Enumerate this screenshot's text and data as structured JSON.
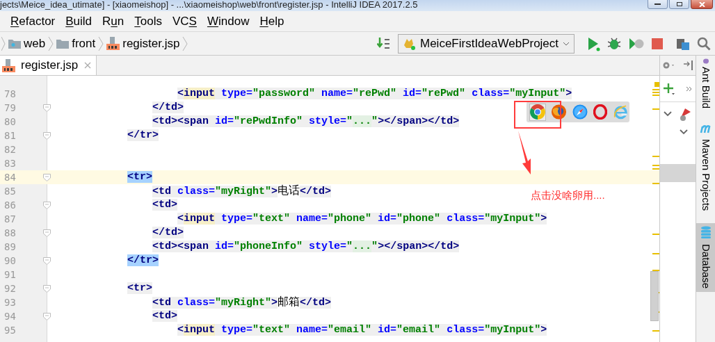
{
  "window": {
    "title": "jects\\Meice_idea_utimate] - [xiaomeishop] - ...\\xiaomeishop\\web\\front\\register.jsp - IntelliJ IDEA 2017.2.5"
  },
  "menu": [
    {
      "key": "R",
      "post": "efactor"
    },
    {
      "key": "B",
      "post": "uild"
    },
    {
      "pre": "R",
      "key": "u",
      "post": "n"
    },
    {
      "key": "T",
      "post": "ools"
    },
    {
      "pre": "VC",
      "key": "S"
    },
    {
      "key": "W",
      "post": "indow"
    },
    {
      "key": "H",
      "post": "elp"
    }
  ],
  "breadcrumbs": [
    {
      "kind": "webfolder",
      "label": "web"
    },
    {
      "kind": "folder",
      "label": "front"
    },
    {
      "kind": "jsp",
      "label": "register.jsp"
    }
  ],
  "run_config": {
    "label": "MeiceFirstIdeaWebProject"
  },
  "tabs": [
    {
      "label": "register.jsp",
      "selected": true
    }
  ],
  "lines": [
    {
      "number": "78",
      "fold": false,
      "current": false,
      "match": false,
      "kind": "input",
      "segs": [
        {
          "kind": "tag",
          "text": "<"
        },
        {
          "kind": "warn",
          "text": "input"
        },
        {
          "kind": "attr",
          "text": " type="
        },
        {
          "kind": "val",
          "text": "\"password\""
        },
        {
          "kind": "attr",
          "text": " name="
        },
        {
          "kind": "val",
          "text": "\"rePwd\""
        },
        {
          "kind": "attr",
          "text": " id="
        },
        {
          "kind": "val",
          "text": "\"rePwd\""
        },
        {
          "kind": "attr",
          "text": " class="
        },
        {
          "kind": "val",
          "text": "\"myInput\""
        },
        {
          "kind": "tag",
          "text": ">"
        }
      ]
    },
    {
      "number": "79",
      "fold": true,
      "current": false,
      "match": false,
      "kind": "td",
      "segs": [
        {
          "kind": "tag",
          "text": "</td>"
        }
      ]
    },
    {
      "number": "80",
      "fold": false,
      "current": false,
      "match": false,
      "kind": "td",
      "segs": [
        {
          "kind": "tag",
          "text": "<td><span"
        },
        {
          "kind": "attr",
          "text": " id="
        },
        {
          "kind": "val",
          "text": "\"rePwdInfo\""
        },
        {
          "kind": "attr",
          "text": " style="
        },
        {
          "kind": "val",
          "text": "\""
        },
        {
          "kind": "folded",
          "text": "..."
        },
        {
          "kind": "val",
          "text": "\""
        },
        {
          "kind": "tag",
          "text": "></span></td>"
        }
      ]
    },
    {
      "number": "81",
      "fold": true,
      "current": false,
      "match": false,
      "kind": "tr",
      "segs": [
        {
          "kind": "tag",
          "text": "</tr>"
        }
      ]
    },
    {
      "number": "82",
      "fold": false,
      "current": false
    },
    {
      "number": "83",
      "fold": false,
      "current": false
    },
    {
      "number": "84",
      "fold": true,
      "current": true,
      "match": true,
      "kind": "tr",
      "segs": [
        {
          "kind": "tag",
          "text": "<tr>"
        }
      ]
    },
    {
      "number": "85",
      "fold": false,
      "current": false,
      "match": false,
      "kind": "td",
      "segs": [
        {
          "kind": "tag",
          "text": "<td"
        },
        {
          "kind": "attr",
          "text": " class="
        },
        {
          "kind": "val",
          "text": "\"myRight\""
        },
        {
          "kind": "tag",
          "text": ">"
        },
        {
          "kind": "text",
          "text": "电话"
        },
        {
          "kind": "tag",
          "text": "</td>"
        }
      ]
    },
    {
      "number": "86",
      "fold": true,
      "current": false,
      "match": false,
      "kind": "td",
      "segs": [
        {
          "kind": "tag",
          "text": "<td>"
        }
      ]
    },
    {
      "number": "87",
      "fold": false,
      "current": false,
      "match": false,
      "kind": "input",
      "segs": [
        {
          "kind": "tag",
          "text": "<"
        },
        {
          "kind": "warn",
          "text": "input"
        },
        {
          "kind": "attr",
          "text": " type="
        },
        {
          "kind": "val",
          "text": "\"text\""
        },
        {
          "kind": "attr",
          "text": " name="
        },
        {
          "kind": "val",
          "text": "\"phone\""
        },
        {
          "kind": "attr",
          "text": " id="
        },
        {
          "kind": "val",
          "text": "\"phone\""
        },
        {
          "kind": "attr",
          "text": " class="
        },
        {
          "kind": "val",
          "text": "\"myInput\""
        },
        {
          "kind": "tag",
          "text": ">"
        }
      ]
    },
    {
      "number": "88",
      "fold": true,
      "current": false,
      "match": false,
      "kind": "td",
      "segs": [
        {
          "kind": "tag",
          "text": "</td>"
        }
      ]
    },
    {
      "number": "89",
      "fold": false,
      "current": false,
      "match": false,
      "kind": "td",
      "segs": [
        {
          "kind": "tag",
          "text": "<td><span"
        },
        {
          "kind": "attr",
          "text": " id="
        },
        {
          "kind": "val",
          "text": "\"phoneInfo\""
        },
        {
          "kind": "attr",
          "text": " style="
        },
        {
          "kind": "val",
          "text": "\""
        },
        {
          "kind": "folded",
          "text": "..."
        },
        {
          "kind": "val",
          "text": "\""
        },
        {
          "kind": "tag",
          "text": "></span></td>"
        }
      ]
    },
    {
      "number": "90",
      "fold": true,
      "current": false,
      "match": true,
      "kind": "tr",
      "segs": [
        {
          "kind": "tag",
          "text": "</tr>"
        }
      ]
    },
    {
      "number": "91",
      "fold": false,
      "current": false
    },
    {
      "number": "92",
      "fold": true,
      "current": false,
      "match": false,
      "kind": "tr",
      "segs": [
        {
          "kind": "tag",
          "text": "<tr>"
        }
      ]
    },
    {
      "number": "93",
      "fold": false,
      "current": false,
      "match": false,
      "kind": "td",
      "segs": [
        {
          "kind": "tag",
          "text": "<td"
        },
        {
          "kind": "attr",
          "text": " class="
        },
        {
          "kind": "val",
          "text": "\"myRight\""
        },
        {
          "kind": "tag",
          "text": ">"
        },
        {
          "kind": "text",
          "text": "邮箱"
        },
        {
          "kind": "tag",
          "text": "</td>"
        }
      ]
    },
    {
      "number": "94",
      "fold": true,
      "current": false,
      "match": false,
      "kind": "td",
      "segs": [
        {
          "kind": "tag",
          "text": "<td>"
        }
      ]
    },
    {
      "number": "95",
      "fold": false,
      "current": false,
      "match": false,
      "kind": "input",
      "segs": [
        {
          "kind": "tag",
          "text": "<"
        },
        {
          "kind": "warn",
          "text": "input"
        },
        {
          "kind": "attr",
          "text": " type="
        },
        {
          "kind": "val",
          "text": "\"text\""
        },
        {
          "kind": "attr",
          "text": " name="
        },
        {
          "kind": "val",
          "text": "\"email\""
        },
        {
          "kind": "attr",
          "text": " id="
        },
        {
          "kind": "val",
          "text": "\"email\""
        },
        {
          "kind": "attr",
          "text": " class="
        },
        {
          "kind": "val",
          "text": "\"myInput\""
        },
        {
          "kind": "tag",
          "text": ">"
        }
      ]
    }
  ],
  "browser_popup": [
    {
      "kind": "chrome",
      "selected": true
    },
    {
      "kind": "firefox",
      "selected": false
    },
    {
      "kind": "safari",
      "selected": false
    },
    {
      "kind": "opera",
      "selected": false
    },
    {
      "kind": "ie",
      "selected": false
    }
  ],
  "annotation": {
    "text": "点击没啥卵用...."
  },
  "tool_strip": [
    {
      "kind": "ant",
      "label": "Ant Build",
      "selected": false
    },
    {
      "kind": "maven",
      "label": "Maven Projects",
      "selected": false
    },
    {
      "kind": "database",
      "label": "Database",
      "selected": true
    }
  ]
}
